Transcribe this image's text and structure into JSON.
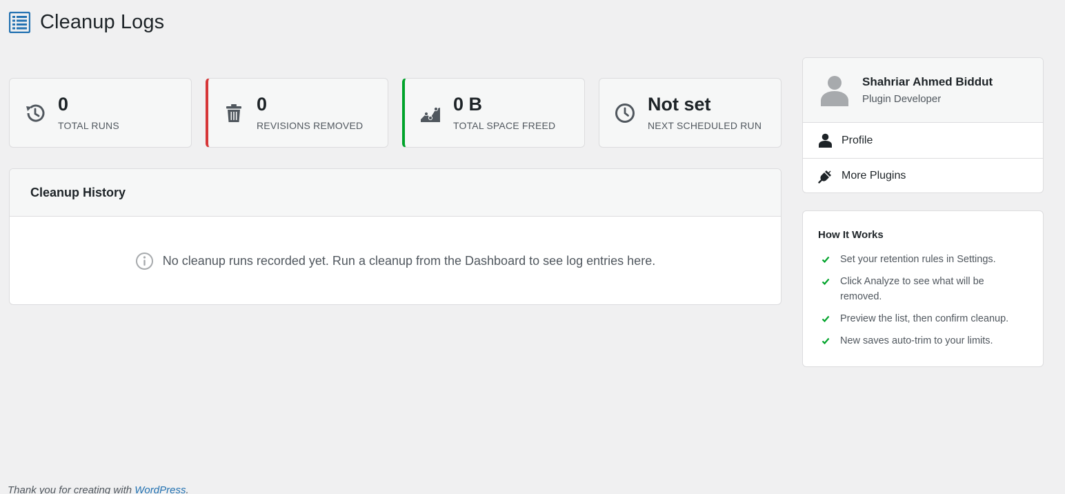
{
  "page": {
    "title": "Cleanup Logs",
    "title_icon": "list-icon",
    "accent_color": "#2271b1"
  },
  "stats": [
    {
      "value": "0",
      "label": "TOTAL RUNS",
      "icon": "history-icon",
      "accent": null
    },
    {
      "value": "0",
      "label": "REVISIONS REMOVED",
      "icon": "trash-icon",
      "accent": "#d63638"
    },
    {
      "value": "0 B",
      "label": "TOTAL SPACE FREED",
      "icon": "area-chart-icon",
      "accent": "#00a32a"
    },
    {
      "value": "Not set",
      "label": "NEXT SCHEDULED RUN",
      "icon": "clock-icon",
      "accent": null
    }
  ],
  "history": {
    "title": "Cleanup History",
    "empty_message": "No cleanup runs recorded yet. Run a cleanup from the Dashboard to see log entries here.",
    "empty_icon": "info-icon"
  },
  "profile": {
    "name": "Shahriar Ahmed Biddut",
    "role": "Plugin Developer",
    "links": [
      {
        "label": "Profile",
        "icon": "user-icon"
      },
      {
        "label": "More Plugins",
        "icon": "plug-icon"
      }
    ]
  },
  "how_it_works": {
    "title": "How It Works",
    "check_color": "#00a32a",
    "steps": [
      "Set your retention rules in Settings.",
      "Click Analyze to see what will be removed.",
      "Preview the list, then confirm cleanup.",
      "New saves auto-trim to your limits."
    ]
  },
  "footer": {
    "text": "Thank you for creating with ",
    "link_label": "WordPress",
    "suffix": "."
  }
}
